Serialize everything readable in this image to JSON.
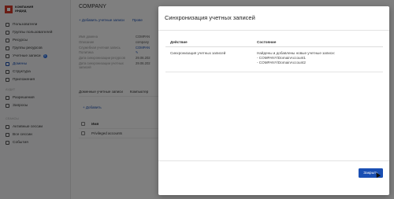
{
  "app": {
    "logo_text_1": "КОМПАНИЯ",
    "logo_text_2": "ИНДИД",
    "nav_items": [
      {
        "label": "Пользователи"
      },
      {
        "label": "Группы пользователей"
      },
      {
        "label": "Ресурсы"
      },
      {
        "label": "Группы ресурсов"
      },
      {
        "label": "Учетные записи",
        "badge": "5"
      },
      {
        "label": "Домены"
      },
      {
        "label": "Структура"
      },
      {
        "label": "Приложения"
      }
    ],
    "section_2": "АУДИТ",
    "nav_items_2": [
      {
        "label": "Разрешения"
      },
      {
        "label": "Запросы"
      }
    ],
    "section_3": "СЕАНСЫ",
    "nav_items_3": [
      {
        "label": "Активные сессии"
      },
      {
        "label": "Все сессии"
      },
      {
        "label": "События"
      }
    ],
    "page_title": "COMPANY",
    "toolbar": {
      "add_accounts": "+ Добавить учетные записи",
      "check": "Прове"
    },
    "details": [
      {
        "k": "Имя домена",
        "v": "COMPAN"
      },
      {
        "k": "Описание",
        "v": "company"
      },
      {
        "k": "Служебная учетная запись",
        "v": "COMPAN"
      },
      {
        "k": "Политика",
        "v": "✎"
      },
      {
        "k": "Дата синхронизации ресурсов",
        "v": "29.06.202"
      },
      {
        "k": "Дата синхронизации учетных записей",
        "v": "29.06.202"
      }
    ],
    "tabs": [
      "Доменные учетные записи",
      "Компьютер"
    ],
    "add_link": "+ Добавить",
    "table_header": "Имя",
    "table_rows": [
      "Privileged accounts"
    ]
  },
  "modal": {
    "title": "Синхронизация учетных записей",
    "columns": [
      "Действие",
      "Состояние"
    ],
    "rows": [
      {
        "action": "Синхронизация учетных записей",
        "status_line_1": "Найдены и добавлены новые учетные записи:",
        "status_line_2": "- COMPANY\\DomainAccount1",
        "status_line_3": "- COMPANY\\DomainAccount2"
      }
    ],
    "close_label": "Закрыть"
  }
}
